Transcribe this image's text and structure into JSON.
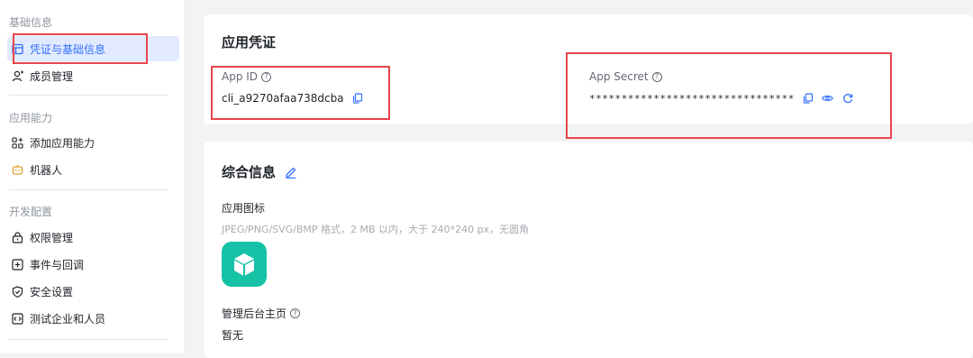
{
  "sidebar": {
    "groups": [
      {
        "title": "基础信息",
        "items": [
          {
            "label": "凭证与基础信息",
            "icon": "credential-icon"
          },
          {
            "label": "成员管理",
            "icon": "member-icon"
          }
        ]
      },
      {
        "title": "应用能力",
        "items": [
          {
            "label": "添加应用能力",
            "icon": "grid-add-icon"
          },
          {
            "label": "机器人",
            "icon": "robot-icon"
          }
        ]
      },
      {
        "title": "开发配置",
        "items": [
          {
            "label": "权限管理",
            "icon": "lock-icon"
          },
          {
            "label": "事件与回调",
            "icon": "event-icon"
          },
          {
            "label": "安全设置",
            "icon": "shield-icon"
          },
          {
            "label": "测试企业和人员",
            "icon": "code-icon"
          }
        ]
      }
    ]
  },
  "credentials": {
    "title": "应用凭证",
    "app_id_label": "App ID",
    "app_id_value": "cli_a9270afaa738dcba",
    "app_secret_label": "App Secret",
    "app_secret_value": "********************************"
  },
  "info": {
    "title": "综合信息",
    "icon_label": "应用图标",
    "icon_hint": "JPEG/PNG/SVG/BMP 格式，2 MB 以内，大于 240*240 px，无圆角",
    "admin_label": "管理后台主页",
    "admin_value": "暂无"
  },
  "colors": {
    "accent": "#3370ff",
    "highlight_box": "#e8454b",
    "app_icon": "#16c2a6"
  }
}
